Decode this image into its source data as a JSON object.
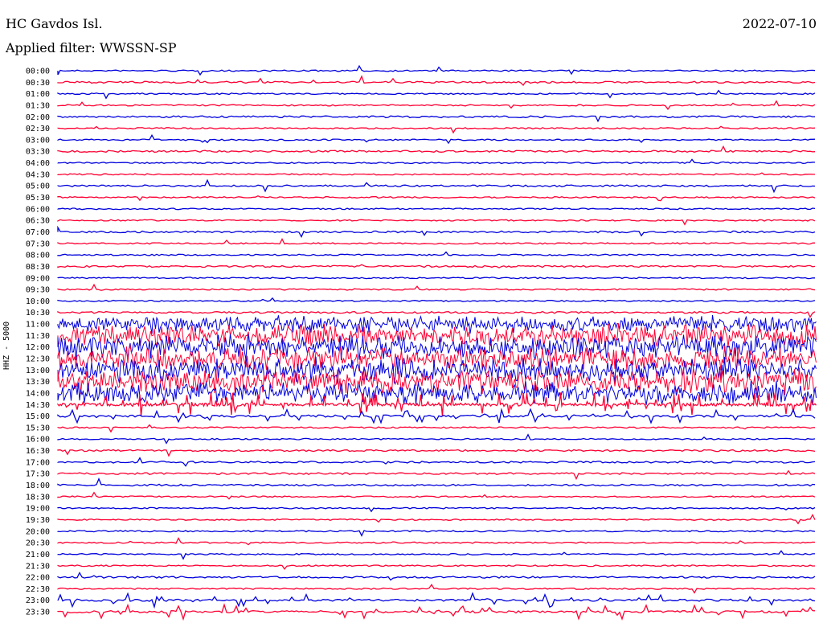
{
  "header": {
    "station": "HC Gavdos Isl.",
    "date": "2022-07-10",
    "filter": "Applied filter: WWSSN-SP",
    "channel": "HHZ - 5000"
  },
  "chart_data": {
    "type": "line",
    "title": "HC Gavdos Isl.",
    "xlabel": "",
    "ylabel": "HHZ - 5000",
    "grid": false,
    "series_colors": [
      "#0000dd",
      "#ff0033"
    ],
    "tick_labels": [
      "00:00",
      "00:30",
      "01:00",
      "01:30",
      "02:00",
      "02:30",
      "03:00",
      "03:30",
      "04:00",
      "04:30",
      "05:00",
      "05:30",
      "06:00",
      "06:30",
      "07:00",
      "07:30",
      "08:00",
      "08:30",
      "09:00",
      "09:30",
      "10:00",
      "10:30",
      "11:00",
      "11:30",
      "12:00",
      "12:30",
      "13:00",
      "13:30",
      "14:00",
      "14:30",
      "15:00",
      "15:30",
      "16:00",
      "16:30",
      "17:00",
      "17:30",
      "18:00",
      "18:30",
      "19:00",
      "19:30",
      "20:00",
      "20:30",
      "21:00",
      "21:30",
      "22:00",
      "22:30",
      "23:00",
      "23:30"
    ],
    "trace_activity": [
      1,
      2,
      1,
      1,
      2,
      1,
      1,
      2,
      1,
      1,
      2,
      1,
      1,
      1,
      2,
      1,
      1,
      2,
      1,
      1,
      1,
      2,
      6,
      8,
      9,
      9,
      9,
      9,
      8,
      5,
      3,
      1,
      1,
      2,
      2,
      2,
      2,
      1,
      1,
      1,
      1,
      1,
      1,
      1,
      2,
      1,
      3,
      3
    ]
  }
}
